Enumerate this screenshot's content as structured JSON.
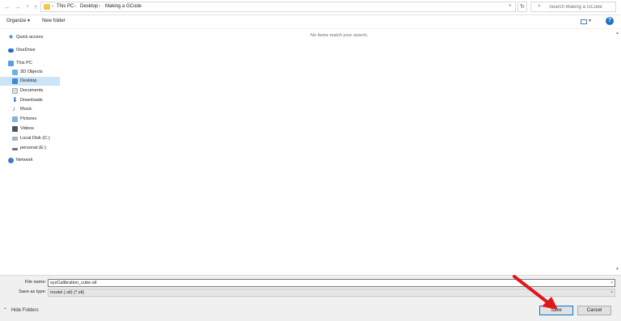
{
  "address_bar": {
    "breadcrumbs": [
      "This PC",
      "Desktop",
      "Making a GCode"
    ],
    "search_placeholder": "Search Making a GCode"
  },
  "command_bar": {
    "organize": "Organize ▾",
    "new_folder": "New folder"
  },
  "nav": {
    "items": [
      {
        "label": "Quick access",
        "icon": "star-icon"
      },
      {
        "label": "OneDrive",
        "icon": "cloud-icon"
      },
      {
        "label": "This PC",
        "icon": "computer-icon"
      },
      {
        "label": "3D Objects",
        "icon": "cube-icon"
      },
      {
        "label": "Desktop",
        "icon": "desktop-icon",
        "selected": true
      },
      {
        "label": "Documents",
        "icon": "document-icon"
      },
      {
        "label": "Downloads",
        "icon": "download-icon"
      },
      {
        "label": "Music",
        "icon": "music-icon"
      },
      {
        "label": "Pictures",
        "icon": "picture-icon"
      },
      {
        "label": "Videos",
        "icon": "video-icon"
      },
      {
        "label": "Local Disk (C:)",
        "icon": "disk-icon"
      },
      {
        "label": "personal (E:)",
        "icon": "drive-icon"
      },
      {
        "label": "Network",
        "icon": "network-icon"
      }
    ]
  },
  "main": {
    "empty_message": "No items match your search."
  },
  "bottom": {
    "file_name_label": "File name:",
    "file_name_value": "xyzCalibration_cube.stl",
    "save_type_label": "Save as type:",
    "save_type_value": "model (.stl) (*.stl)",
    "hide_folders": "Hide Folders",
    "save_button": "Save",
    "cancel_button": "Cancel"
  },
  "colors": {
    "selection": "#cce4f7",
    "arrow": "#e0161b",
    "folder": "#f2c94c"
  }
}
